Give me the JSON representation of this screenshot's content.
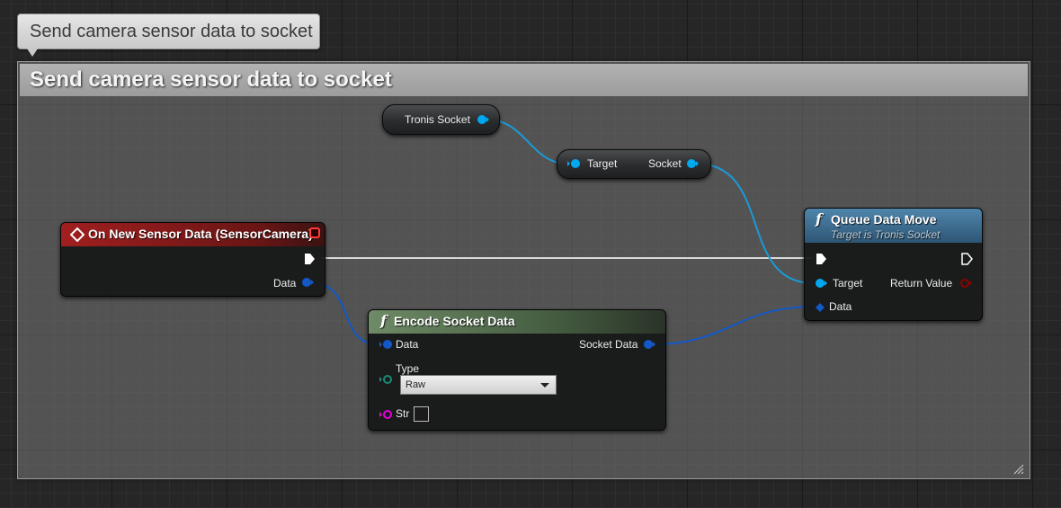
{
  "comment": {
    "bubble_text": "Send camera sensor data to socket",
    "title": "Send camera sensor data to socket"
  },
  "nodes": {
    "event": {
      "title": "On New Sensor Data (SensorCamera)",
      "pin_data": "Data",
      "header_color": "#8a1c1c",
      "header_icon": "event-diamond-icon"
    },
    "tronis_socket": {
      "label": "Tronis Socket"
    },
    "socket_getter": {
      "pin_target": "Target",
      "pin_socket": "Socket"
    },
    "encode": {
      "title": "Encode Socket Data",
      "function_glyph": "f",
      "header_color": "#5f7a5a",
      "pin_data": "Data",
      "pin_socket_data": "Socket Data",
      "pin_type": "Type",
      "type_value": "Raw",
      "pin_str": "Str"
    },
    "queue": {
      "title": "Queue Data Move",
      "subtitle": "Target is Tronis Socket",
      "function_glyph": "f",
      "header_color": "#3f6f8e",
      "pin_target": "Target",
      "pin_return": "Return Value",
      "pin_data": "Data"
    }
  },
  "colors": {
    "object_pin": "#00a8f0",
    "struct_pin": "#0c5fd6",
    "enum_pin": "#00695a",
    "string_pin": "#e800d8",
    "bool_pin": "#8c0000",
    "exec_wire": "#ffffff"
  }
}
